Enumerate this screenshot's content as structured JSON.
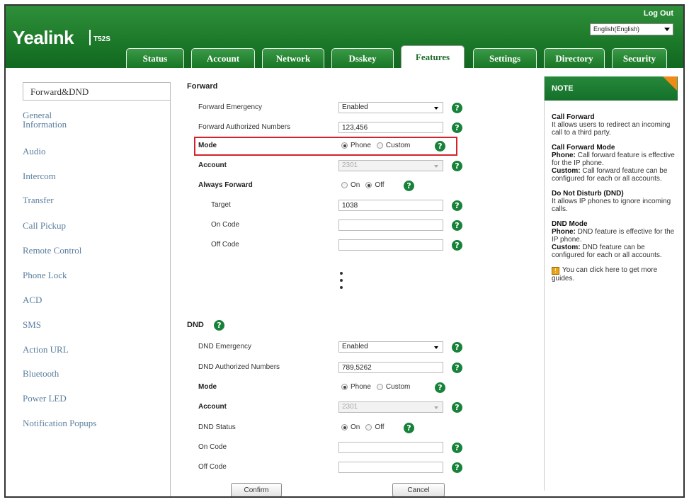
{
  "header": {
    "logo": "Yealink",
    "model": "T52S",
    "logout": "Log Out",
    "language": "English(English)"
  },
  "tabs": [
    "Status",
    "Account",
    "Network",
    "Dsskey",
    "Features",
    "Settings",
    "Directory",
    "Security"
  ],
  "active_tab": "Features",
  "sidebar": {
    "items": [
      "Forward&DND",
      "General Information",
      "Audio",
      "Intercom",
      "Transfer",
      "Call Pickup",
      "Remote Control",
      "Phone Lock",
      "ACD",
      "SMS",
      "Action URL",
      "Bluetooth",
      "Power LED",
      "Notification Popups"
    ],
    "item_lines": [
      [
        "Forward&DND"
      ],
      [
        "General",
        "Information"
      ],
      [
        "Audio"
      ],
      [
        "Intercom"
      ],
      [
        "Transfer"
      ],
      [
        "Call Pickup"
      ],
      [
        "Remote Control"
      ],
      [
        "Phone Lock"
      ],
      [
        "ACD"
      ],
      [
        "SMS"
      ],
      [
        "Action URL"
      ],
      [
        "Bluetooth"
      ],
      [
        "Power LED"
      ],
      [
        "Notification Popups"
      ]
    ],
    "active": "Forward&DND"
  },
  "forward": {
    "title": "Forward",
    "emergency_label": "Forward Emergency",
    "emergency_value": "Enabled",
    "authorized_label": "Forward Authorized Numbers",
    "authorized_value": "123,456",
    "mode_label": "Mode",
    "mode_phone": "Phone",
    "mode_custom": "Custom",
    "account_label": "Account",
    "account_value": "2301",
    "always_label": "Always Forward",
    "always_on": "On",
    "always_off": "Off",
    "target_label": "Target",
    "target_value": "1038",
    "oncode_label": "On Code",
    "oncode_value": "",
    "offcode_label": "Off Code",
    "offcode_value": ""
  },
  "dnd": {
    "title": "DND",
    "emergency_label": "DND Emergency",
    "emergency_value": "Enabled",
    "authorized_label": "DND Authorized Numbers",
    "authorized_value": "789,5262",
    "mode_label": "Mode",
    "mode_phone": "Phone",
    "mode_custom": "Custom",
    "account_label": "Account",
    "account_value": "2301",
    "status_label": "DND Status",
    "status_on": "On",
    "status_off": "Off",
    "oncode_label": "On Code",
    "offcode_label": "Off Code"
  },
  "buttons": {
    "confirm": "Confirm",
    "cancel": "Cancel"
  },
  "note": {
    "title": "NOTE",
    "call_forward_title": "Call Forward",
    "call_forward_text": "It allows users to redirect an incoming call to a third party.",
    "cf_mode_title": "Call Forward Mode",
    "cf_mode_phone_label": "Phone:",
    "cf_mode_phone_text": "Call forward feature is effective for the IP phone.",
    "cf_mode_custom_label": "Custom:",
    "cf_mode_custom_text": "Call forward feature can be configured for each or all accounts.",
    "dnd_title": "Do Not Disturb (DND)",
    "dnd_text": "It allows IP phones to ignore incoming calls.",
    "dnd_mode_title": "DND Mode",
    "dnd_mode_phone_label": "Phone:",
    "dnd_mode_phone_text": "DND feature is effective for the IP phone.",
    "dnd_mode_custom_label": "Custom:",
    "dnd_mode_custom_text": "DND feature can be configured for each or all accounts.",
    "guide_text": "You can click here to get more guides."
  },
  "colors": {
    "header_green": "#1d7a2a",
    "help_green": "#17823a",
    "highlight_red": "#d0242a",
    "note_corner": "#f08a14",
    "sidebar_link": "#5b7f9e"
  }
}
